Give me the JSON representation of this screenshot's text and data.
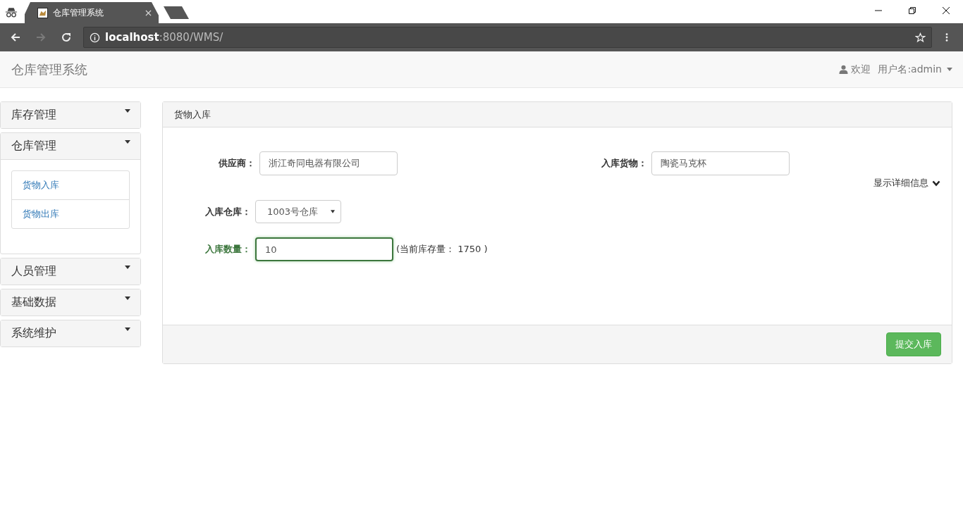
{
  "browser": {
    "tab_title": "仓库管理系统",
    "address_host": "localhost",
    "address_rest": ":8080/WMS/",
    "forward_disabled": true
  },
  "navbar": {
    "brand": "仓库管理系统",
    "welcome": "欢迎",
    "user": "用户名:admin"
  },
  "sidebar": [
    {
      "label": "库存管理",
      "expanded": false
    },
    {
      "label": "仓库管理",
      "expanded": true,
      "children": [
        {
          "label": "货物入库"
        },
        {
          "label": "货物出库"
        }
      ]
    },
    {
      "label": "人员管理",
      "expanded": false
    },
    {
      "label": "基础数据",
      "expanded": false
    },
    {
      "label": "系统维护",
      "expanded": false
    }
  ],
  "panel": {
    "title": "货物入库",
    "details_toggle": "显示详细信息",
    "submit": "提交入库",
    "fields": [
      {
        "kind": "text",
        "label": "供应商：",
        "value": "浙江奇同电器有限公司",
        "valid": false
      },
      {
        "kind": "text",
        "label": "入库货物：",
        "value": "陶瓷马克杯",
        "valid": false
      },
      {
        "kind": "select",
        "label": "入库仓库：",
        "value": "1003号仓库",
        "valid": false
      },
      {
        "kind": "text",
        "label": "入库数量：",
        "value": "10",
        "valid": true,
        "hint": "(当前库存量： 1750 )"
      }
    ]
  }
}
